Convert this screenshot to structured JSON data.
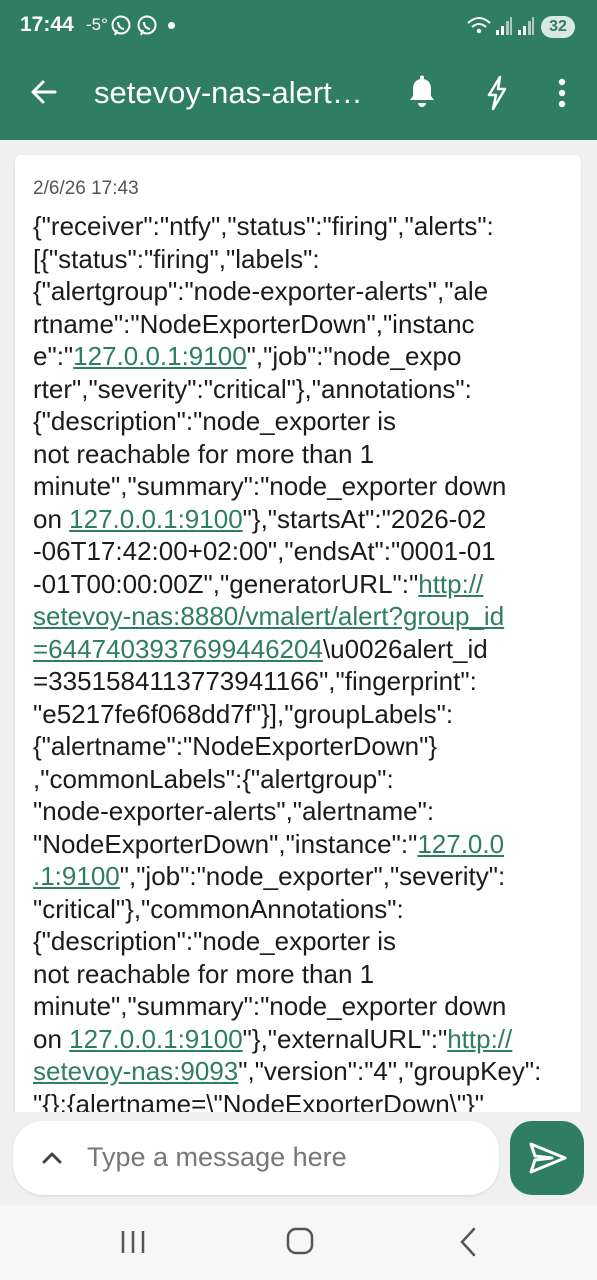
{
  "status_bar": {
    "time": "17:44",
    "temperature": "-5°",
    "battery": "32",
    "icons": [
      "viber-icon",
      "viber-icon",
      "notification-dot",
      "wifi-calling-icon",
      "signal-icon",
      "signal-icon"
    ]
  },
  "app_bar": {
    "title": "setevoy-nas-alert…",
    "back_icon": "arrow-left-icon",
    "actions": [
      "bell-icon",
      "lightning-icon",
      "more-vert-icon"
    ],
    "background_color": "#2f7d63"
  },
  "message": {
    "timestamp": "2/6/26 17:43",
    "lines": [
      [
        {
          "t": "{\"receiver\":\"ntfy\",\"status\":\"firing\",\"alerts\":"
        }
      ],
      [
        {
          "t": "[{\"status\":\"firing\",\"labels\":"
        }
      ],
      [
        {
          "t": "{\"alertgroup\":\"node-exporter-alerts\",\"ale"
        }
      ],
      [
        {
          "t": "rtname\":\"NodeExporterDown\",\"instanc"
        }
      ],
      [
        {
          "t": "e\":\""
        },
        {
          "t": "127.0.0.1:9100",
          "link": true
        },
        {
          "t": "\",\"job\":\"node_expo"
        }
      ],
      [
        {
          "t": "rter\",\"severity\":\"critical\"},\"annotations\":"
        }
      ],
      [
        {
          "t": "{\"description\":\"node_exporter is"
        }
      ],
      [
        {
          "t": "not reachable for more than 1"
        }
      ],
      [
        {
          "t": "minute\",\"summary\":\"node_exporter down"
        }
      ],
      [
        {
          "t": "on "
        },
        {
          "t": "127.0.0.1:9100",
          "link": true
        },
        {
          "t": "\"},\"startsAt\":\"2026-02"
        }
      ],
      [
        {
          "t": "-06T17:42:00+02:00\",\"endsAt\":\"0001-01"
        }
      ],
      [
        {
          "t": "-01T00:00:00Z\",\"generatorURL\":\""
        },
        {
          "t": "http://",
          "link": true
        }
      ],
      [
        {
          "t": "setevoy-nas:8880/vmalert/alert?group_id",
          "link": true
        }
      ],
      [
        {
          "t": "=6447403937699446204",
          "link": true
        },
        {
          "t": "\\u0026alert_id"
        }
      ],
      [
        {
          "t": "=3351584113773941166\",\"fingerprint\":"
        }
      ],
      [
        {
          "t": "\"e5217fe6f068dd7f\"}],\"groupLabels\":"
        }
      ],
      [
        {
          "t": "{\"alertname\":\"NodeExporterDown\"}"
        }
      ],
      [
        {
          "t": ",\"commonLabels\":{\"alertgroup\":"
        }
      ],
      [
        {
          "t": "\"node-exporter-alerts\",\"alertname\":"
        }
      ],
      [
        {
          "t": "\"NodeExporterDown\",\"instance\":\""
        },
        {
          "t": "127.0.0",
          "link": true
        }
      ],
      [
        {
          "t": ".1:9100",
          "link": true
        },
        {
          "t": "\",\"job\":\"node_exporter\",\"severity\":"
        }
      ],
      [
        {
          "t": "\"critical\"},\"commonAnnotations\":"
        }
      ],
      [
        {
          "t": "{\"description\":\"node_exporter is"
        }
      ],
      [
        {
          "t": "not reachable for more than 1"
        }
      ],
      [
        {
          "t": "minute\",\"summary\":\"node_exporter down"
        }
      ],
      [
        {
          "t": "on "
        },
        {
          "t": "127.0.0.1:9100",
          "link": true
        },
        {
          "t": "\"},\"externalURL\":\""
        },
        {
          "t": "http://",
          "link": true
        }
      ],
      [
        {
          "t": "setevoy-nas:9093",
          "link": true
        },
        {
          "t": "\",\"version\":\"4\",\"groupKey\":"
        }
      ],
      [
        {
          "t": "\"{}:{alertname=\\\"NodeExporterDown\\\"}\""
        }
      ]
    ]
  },
  "composer": {
    "placeholder": "Type a message here",
    "expand_icon": "chevron-up-icon",
    "send_icon": "send-icon"
  },
  "nav_bar": {
    "buttons": [
      "recent-apps-icon",
      "home-icon",
      "back-nav-icon"
    ]
  }
}
